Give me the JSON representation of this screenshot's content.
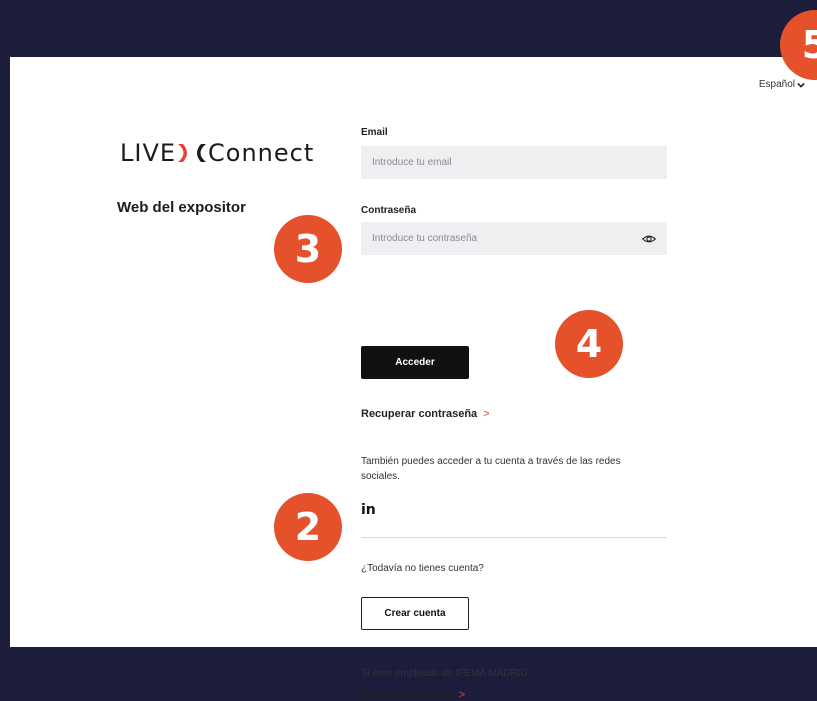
{
  "language": {
    "label": "Español"
  },
  "brand": {
    "logo_left": "LIVE",
    "logo_right": "Connect",
    "subtitle": "Web del expositor"
  },
  "login": {
    "email_label": "Email",
    "email_placeholder": "Introduce tu email",
    "password_label": "Contraseña",
    "password_placeholder": "Introduce tu contraseña",
    "submit_label": "Acceder",
    "recover_label": "Recuperar contraseña",
    "social_text": "También puedes acceder a tu cuenta a través de las redes sociales.",
    "linkedin_label": "in"
  },
  "signup": {
    "prompt": "¿Todavía no tienes cuenta?",
    "create_label": "Crear cuenta",
    "employee_text": "Si eres empleado de IFEMA MADRID",
    "employee_link": "Inicia sesión aquí"
  },
  "annotations": [
    "3",
    "4",
    "2",
    "5"
  ],
  "colors": {
    "background": "#1b1d3a",
    "accent": "#e8403b",
    "badge": "#e4512a",
    "button": "#111111"
  }
}
